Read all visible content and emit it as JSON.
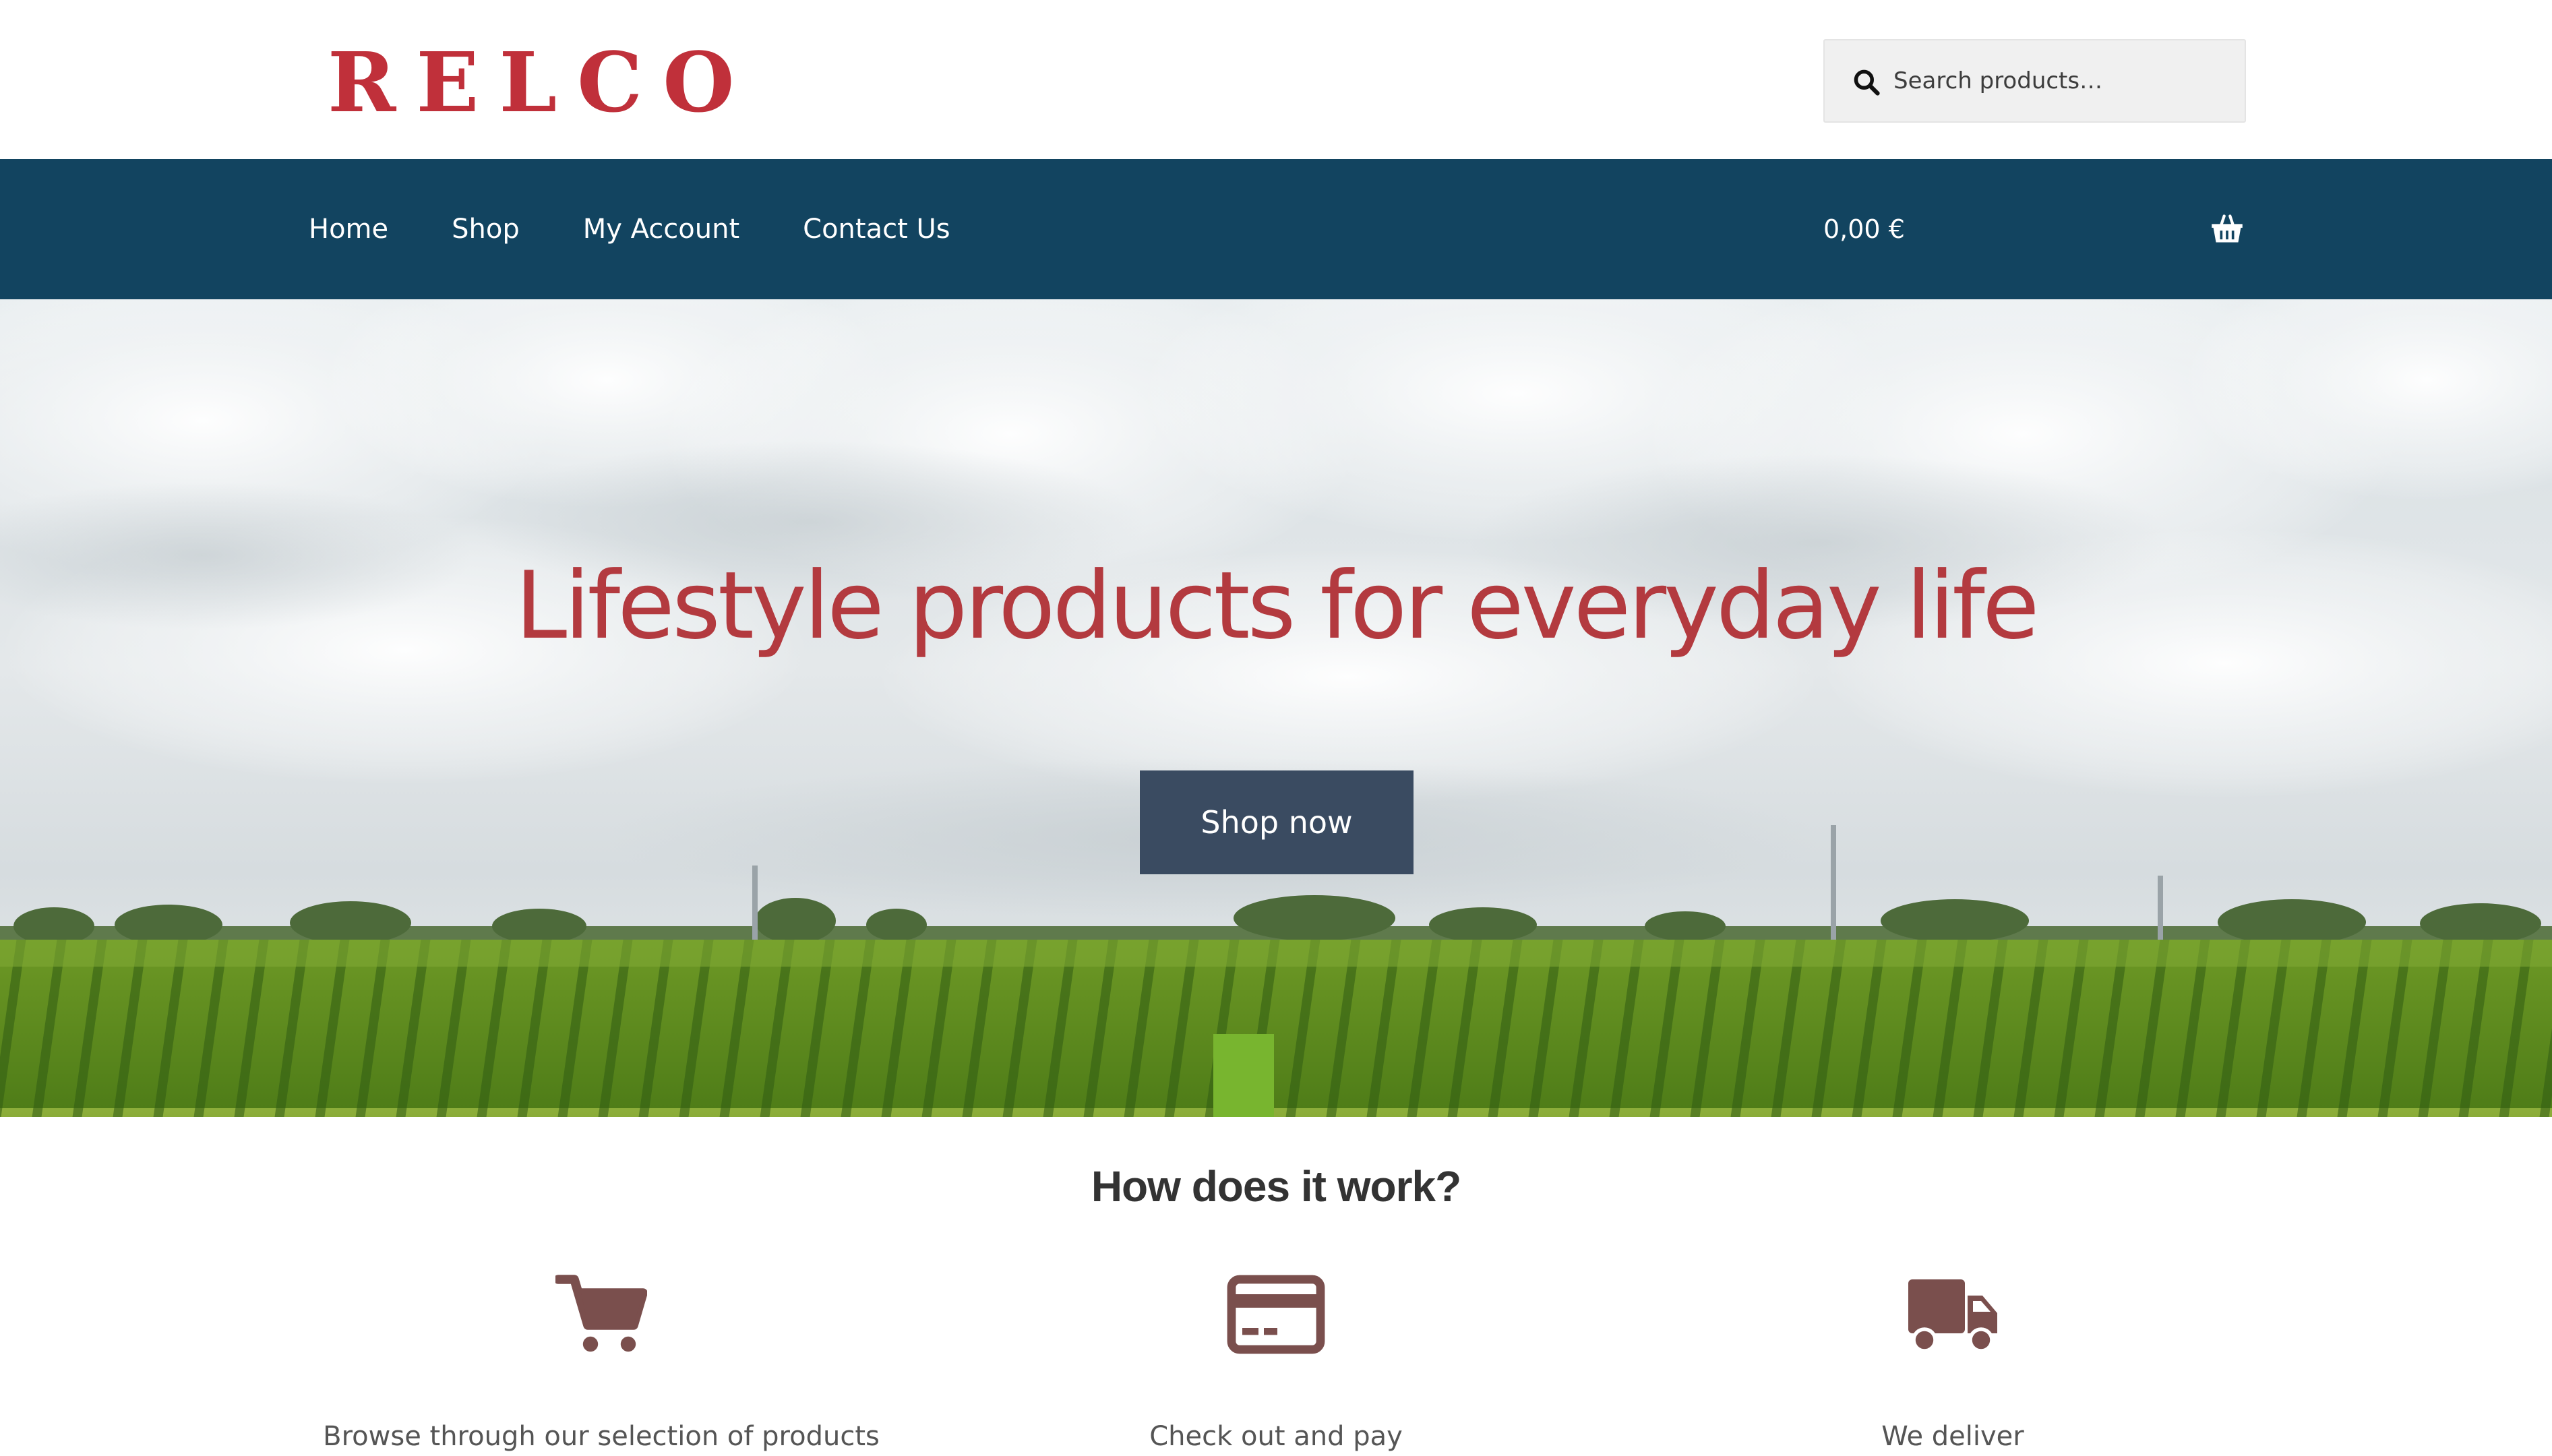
{
  "brand": {
    "logo_text": "RELCO",
    "logo_color": "#c0303a"
  },
  "search": {
    "placeholder": "Search products…",
    "icon": "search-icon"
  },
  "nav": {
    "items": [
      {
        "label": "Home"
      },
      {
        "label": "Shop"
      },
      {
        "label": "My Account"
      },
      {
        "label": "Contact Us"
      }
    ],
    "cart_total": "0,00 €",
    "cart_icon": "basket-icon",
    "background": "#124460"
  },
  "hero": {
    "title": "Lifestyle products for everyday life",
    "button_label": "Shop now",
    "title_color": "#b33a3f",
    "button_color": "#3a4b61"
  },
  "how_it_works": {
    "title": "How does it work?",
    "icon_color": "#7a4f4d",
    "steps": [
      {
        "icon": "shopping-cart-icon",
        "caption": "Browse through our selection of products"
      },
      {
        "icon": "credit-card-icon",
        "caption": "Check out and pay"
      },
      {
        "icon": "delivery-truck-icon",
        "caption": "We deliver"
      }
    ]
  }
}
